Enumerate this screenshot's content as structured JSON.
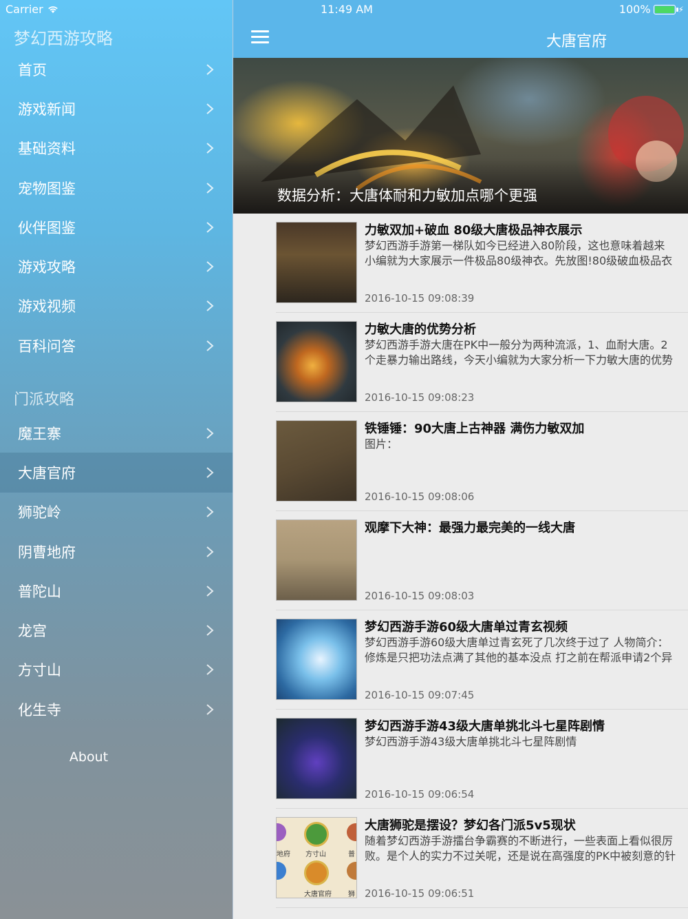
{
  "status_bar": {
    "carrier": "Carrier",
    "time": "11:49 AM",
    "battery": "100%"
  },
  "sidebar": {
    "title": "梦幻西游攻略",
    "items": [
      {
        "label": "首页"
      },
      {
        "label": "游戏新闻"
      },
      {
        "label": "基础资料"
      },
      {
        "label": "宠物图鉴"
      },
      {
        "label": "伙伴图鉴"
      },
      {
        "label": "游戏攻略"
      },
      {
        "label": "游戏视频"
      },
      {
        "label": "百科问答"
      }
    ],
    "section_title": "门派攻略",
    "sect_items": [
      {
        "label": "魔王寨"
      },
      {
        "label": "大唐官府"
      },
      {
        "label": "狮驼岭"
      },
      {
        "label": "阴曹地府"
      },
      {
        "label": "普陀山"
      },
      {
        "label": "龙宫"
      },
      {
        "label": "方寸山"
      },
      {
        "label": "化生寺"
      }
    ],
    "about": "About"
  },
  "header": {
    "title": "大唐官府"
  },
  "banner": {
    "caption": "数据分析：大唐体耐和力敏加点哪个更强"
  },
  "articles": [
    {
      "title": "力敏双加+破血 80级大唐极品神衣展示",
      "summary": "梦幻西游手游第一梯队如今已经进入80阶段，这也意味着越来\n小编就为大家展示一件极品80级神衣。先放图!80级破血极品衣",
      "time": "2016-10-15 09:08:39"
    },
    {
      "title": "力敏大唐的优势分析",
      "summary": "梦幻西游手游大唐在PK中一般分为两种流派，1、血耐大唐。2\n个走暴力输出路线，今天小编就为大家分析一下力敏大唐的优势",
      "time": "2016-10-15 09:08:23"
    },
    {
      "title": "铁锤锤：90大唐上古神器 满伤力敏双加",
      "summary": "图片：",
      "time": "2016-10-15 09:08:06"
    },
    {
      "title": "观摩下大神：最强力最完美的一线大唐",
      "summary": "",
      "time": "2016-10-15 09:08:03"
    },
    {
      "title": "梦幻西游手游60级大唐单过青玄视频",
      "summary": "梦幻西游手游60级大唐单过青玄死了几次终于过了 人物简介：\n修炼是只把功法点满了其他的基本没点 打之前在帮派申请2个异",
      "time": "2016-10-15 09:07:45"
    },
    {
      "title": "梦幻西游手游43级大唐单挑北斗七星阵剧情",
      "summary": "梦幻西游手游43级大唐单挑北斗七星阵剧情",
      "time": "2016-10-15 09:06:54"
    },
    {
      "title": "大唐狮驼是摆设？梦幻各门派5v5现状",
      "summary": "随着梦幻西游手游擂台争霸赛的不断进行，一些表面上看似很厉\n败。是个人的实力不过关呢，还是说在高强度的PK中被刻意的针",
      "time": "2016-10-15 09:06:51"
    }
  ],
  "thumb7_labels": [
    "地府",
    "方寸山",
    "普",
    "大唐官府",
    "狮"
  ],
  "colors": {
    "nav_bar": "#5bb6ea",
    "sidebar_top": "#62c6f6",
    "sidebar_bottom": "#8a9196",
    "battery_green": "#4cd964"
  }
}
